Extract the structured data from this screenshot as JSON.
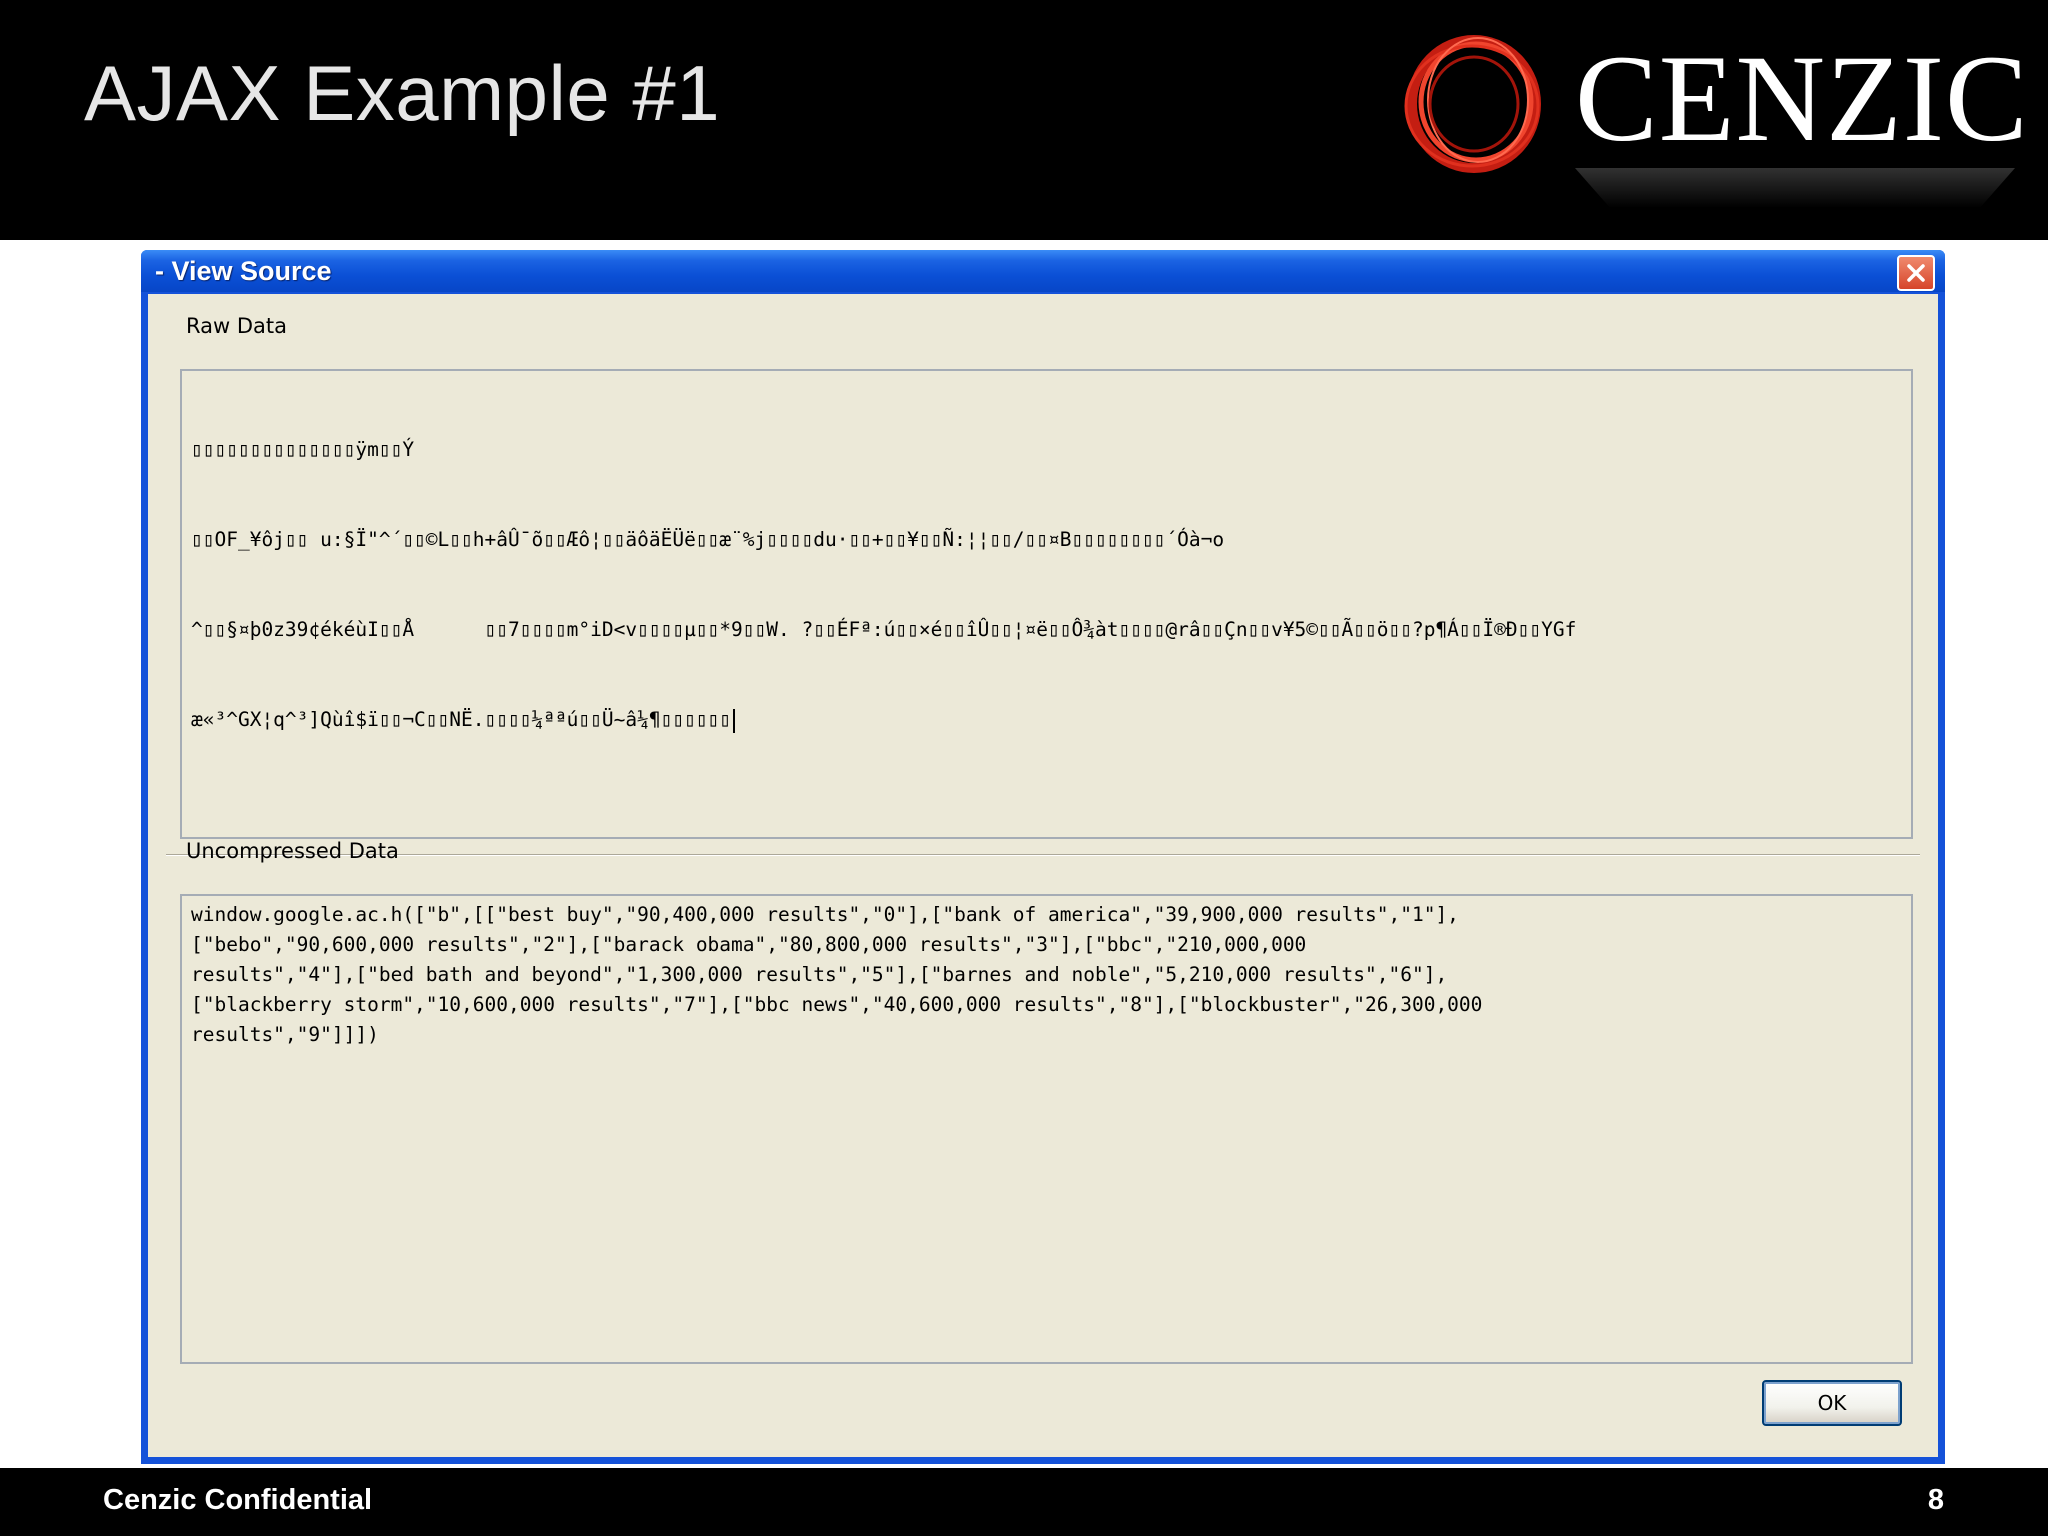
{
  "slide": {
    "title": "AJAX Example #1",
    "logo_text": "CENZIC",
    "footer": "Cenzic Confidential",
    "page_number": "8"
  },
  "colors": {
    "header_bg": "#000000",
    "logo_ring": "#e0301e",
    "titlebar": "#0b50d6",
    "dialog_bg": "#ece9d8"
  },
  "dialog": {
    "title": "- View Source",
    "close_icon": "close-x-icon",
    "raw_label": "Raw Data",
    "raw_lines": [
      "▯▯▯▯▯▯▯▯▯▯▯▯▯▯ÿm▯▯Ý",
      "▯▯OF_¥ôj▯▯ u:§Ï\"^´▯▯©L▯▯h+âÛ¯õ▯▯Æô¦▯▯äôäËÜë▯▯æ¨%j▯▯▯▯du·▯▯+▯▯¥▯▯Ñ:¦¦▯▯/▯▯¤B▯▯▯▯▯▯▯▯´Óà¬o",
      "^▯▯§¤þ0z39¢ékéùI▯▯Å      ▯▯7▯▯▯▯m°iD<v▯▯▯▯µ▯▯*9▯▯W. ?▯▯ÉFª:ú▯▯×é▯▯îÛ▯▯¦¤ë▯▯Ô¾àt▯▯▯▯@râ▯▯Çn▯▯v¥5©▯▯Ã▯▯ö▯▯?p¶Á▯▯Ï®Ð▯▯YGf",
      "æ«³^GX¦q^³]Qùî$ï▯▯¬C▯▯NË.▯▯▯▯¼ªªú▯▯Ü~â¼¶▯▯▯▯▯▯"
    ],
    "uncompressed_label": "Uncompressed Data",
    "uncompressed_text": "window.google.ac.h([\"b\",[[\"best buy\",\"90,400,000 results\",\"0\"],[\"bank of america\",\"39,900,000 results\",\"1\"],\n[\"bebo\",\"90,600,000 results\",\"2\"],[\"barack obama\",\"80,800,000 results\",\"3\"],[\"bbc\",\"210,000,000\nresults\",\"4\"],[\"bed bath and beyond\",\"1,300,000 results\",\"5\"],[\"barnes and noble\",\"5,210,000 results\",\"6\"],\n[\"blackberry storm\",\"10,600,000 results\",\"7\"],[\"bbc news\",\"40,600,000 results\",\"8\"],[\"blockbuster\",\"26,300,000\nresults\",\"9\"]]])",
    "ok_label": "OK"
  }
}
